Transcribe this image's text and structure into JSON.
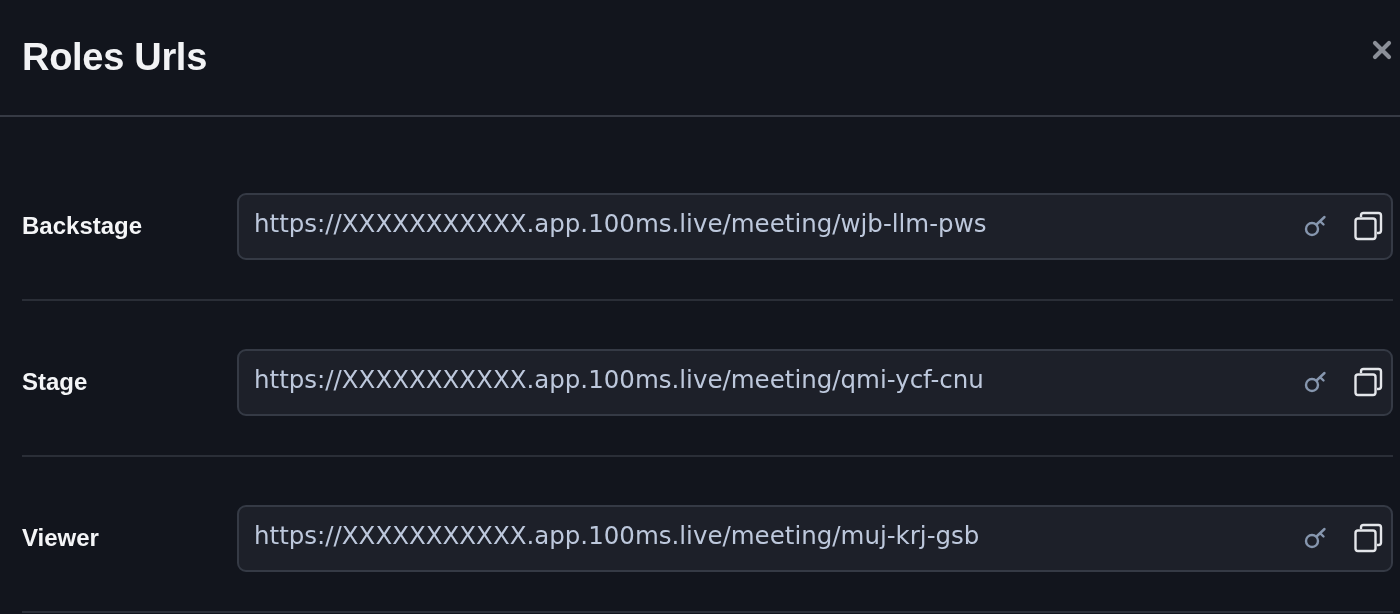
{
  "dialog": {
    "title": "Roles Urls"
  },
  "roles": [
    {
      "label": "Backstage",
      "url": "https://XXXXXXXXXXX.app.100ms.live/meeting/wjb-llm-pws"
    },
    {
      "label": "Stage",
      "url": "https://XXXXXXXXXXX.app.100ms.live/meeting/qmi-ycf-cnu"
    },
    {
      "label": "Viewer",
      "url": "https://XXXXXXXXXXX.app.100ms.live/meeting/muj-krj-gsb"
    }
  ]
}
